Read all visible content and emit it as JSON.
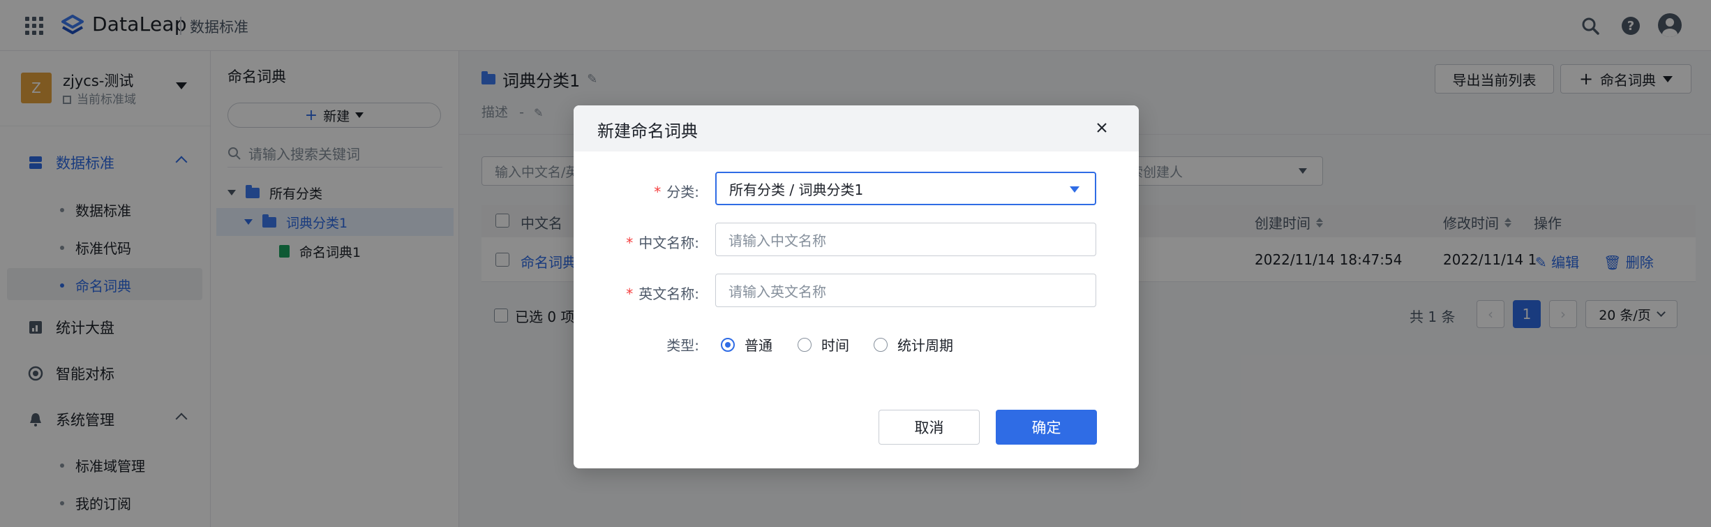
{
  "header": {
    "brand": "DataLeap",
    "app_title": "数据标准"
  },
  "workspace": {
    "avatar_letter": "Z",
    "name": "zjycs-测试",
    "subtitle": "当前标准域"
  },
  "nav": {
    "data_standard": "数据标准",
    "sub_items": [
      "数据标准",
      "标准代码",
      "命名词典"
    ],
    "stats": "统计大盘",
    "smart_benchmark": "智能对标",
    "system_mgmt": "系统管理",
    "system_sub": [
      "标准域管理",
      "我的订阅"
    ]
  },
  "tree": {
    "title": "命名词典",
    "new_button": "新建",
    "search_placeholder": "请输入搜索关键词",
    "nodes": [
      "所有分类",
      "词典分类1",
      "命名词典1"
    ]
  },
  "main": {
    "title": "词典分类1",
    "desc_label": "描述",
    "desc_value": "-",
    "export_button": "导出当前列表",
    "add_button": "命名词典",
    "filter_name_placeholder": "输入中文名/英",
    "filter_creator_placeholder": "索创建人",
    "columns": {
      "name": "中文名",
      "created": "创建时间",
      "modified": "修改时间",
      "ops": "操作"
    },
    "row": {
      "name": "命名词典",
      "created": "2022/11/14 18:47:54",
      "modified": "2022/11/14 1",
      "edit": "编辑",
      "delete": "删除"
    },
    "selected_text": "已选 0 项",
    "total_text": "共 1 条",
    "current_page": "1",
    "page_size": "20 条/页"
  },
  "modal": {
    "title": "新建命名词典",
    "category_label": "分类:",
    "category_value": "所有分类 / 词典分类1",
    "cn_name_label": "中文名称:",
    "cn_name_placeholder": "请输入中文名称",
    "en_name_label": "英文名称:",
    "en_name_placeholder": "请输入英文名称",
    "type_label": "类型:",
    "type_options": [
      "普通",
      "时间",
      "统计周期"
    ],
    "type_selected": "普通",
    "cancel": "取消",
    "confirm": "确定"
  },
  "colors": {
    "primary": "#2f6ce5",
    "required": "#f53f3f",
    "workspace_avatar": "#e6a23c"
  }
}
